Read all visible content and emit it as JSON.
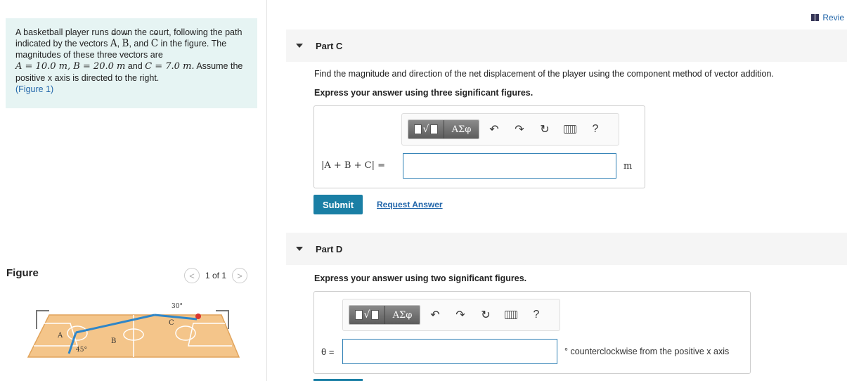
{
  "problem": {
    "line1": "A basketball player runs down the court, following the path indicated by the vectors",
    "vecA": "A",
    "comma": ",",
    "vecB": "B",
    "and": ", and",
    "vecC": "C",
    "line2": "in the figure. The magnitudes of these three vectors are",
    "mags": "A = 10.0 m, B = 20.0 m",
    "and2": "and",
    "magC": "C = 7.0 m.",
    "assume": "Assume the positive x axis is directed to the right.",
    "figlink": "(Figure 1)"
  },
  "figure": {
    "title": "Figure",
    "pager": "1 of 1",
    "prev": "<",
    "next": ">",
    "labels": {
      "A": "A",
      "B": "B",
      "C": "C",
      "angle45": "45°",
      "angle30": "30°"
    }
  },
  "review": "Revie",
  "partC": {
    "header": "Part C",
    "question": "Find the magnitude and direction of the net displacement of the player using the component method of vector addition.",
    "instruction": "Express your answer using three significant figures.",
    "lhs": "|A + B + C| =",
    "unit": "m",
    "submit": "Submit",
    "request": "Request Answer"
  },
  "partD": {
    "header": "Part D",
    "instruction": "Express your answer using two significant figures.",
    "lhs": "θ =",
    "unit": "° counterclockwise from the positive x axis"
  },
  "toolbar": {
    "greek": "ΑΣφ",
    "help": "?"
  }
}
